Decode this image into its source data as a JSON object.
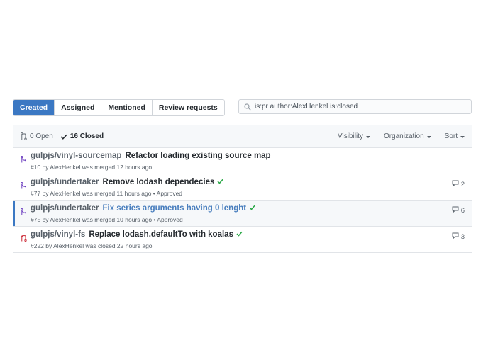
{
  "tabs": [
    {
      "label": "Created",
      "active": true
    },
    {
      "label": "Assigned",
      "active": false
    },
    {
      "label": "Mentioned",
      "active": false
    },
    {
      "label": "Review requests",
      "active": false
    }
  ],
  "search": {
    "value": "is:pr author:AlexHenkel is:closed"
  },
  "header": {
    "open_label": "0 Open",
    "closed_label": "16 Closed",
    "filters": [
      "Visibility",
      "Organization",
      "Sort"
    ]
  },
  "pulls": [
    {
      "icon": "merged-pr-icon",
      "repo": "gulpjs/vinyl-sourcemap",
      "title": "Refactor loading existing source map",
      "meta": "#10 by AlexHenkel was merged 12 hours ago",
      "check": false,
      "comments": "",
      "highlight": false
    },
    {
      "icon": "merged-pr-icon",
      "repo": "gulpjs/undertaker",
      "title": "Remove lodash dependecies",
      "meta": "#77 by AlexHenkel was merged 11 hours ago • Approved",
      "check": true,
      "comments": "2",
      "highlight": false
    },
    {
      "icon": "merged-pr-icon",
      "repo": "gulpjs/undertaker",
      "title": "Fix series arguments having 0 lenght",
      "meta": "#75 by AlexHenkel was merged 10 hours ago • Approved",
      "check": true,
      "comments": "6",
      "highlight": true
    },
    {
      "icon": "closed-pr-icon",
      "repo": "gulpjs/vinyl-fs",
      "title": "Replace lodash.defaultTo with koalas",
      "meta": "#222 by AlexHenkel was closed 22 hours ago",
      "check": true,
      "comments": "3",
      "highlight": false
    }
  ],
  "colors": {
    "accent": "#3b78c3",
    "merged": "#6f42c1",
    "closed": "#cb2431",
    "success": "#28a745"
  }
}
